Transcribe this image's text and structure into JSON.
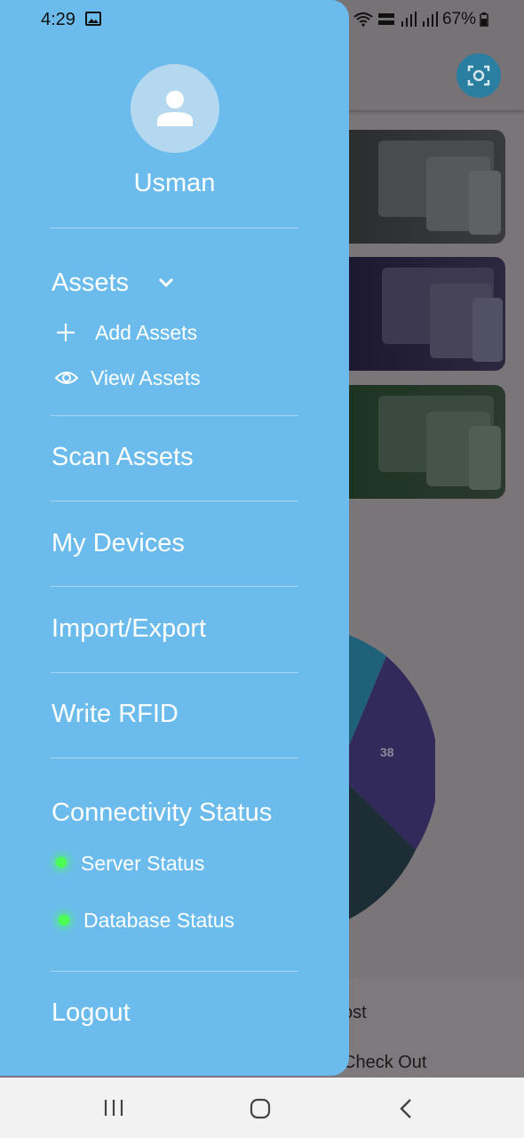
{
  "status_bar": {
    "time": "4:29",
    "battery": "67%"
  },
  "drawer": {
    "username": "Usman",
    "assets": {
      "label": "Assets",
      "items": [
        {
          "label": "Add Assets",
          "icon": "plus-icon"
        },
        {
          "label": "View Assets",
          "icon": "eye-icon"
        }
      ]
    },
    "menu": {
      "scan_assets": "Scan Assets",
      "my_devices": "My Devices",
      "import_export": "Import/Export",
      "write_rfid": "Write RFID",
      "logout": "Logout"
    },
    "connectivity": {
      "title": "Connectivity Status",
      "server": "Server Status",
      "database": "Database Status",
      "indicator_color": "#4cff53"
    },
    "background_color": "#6bbcec"
  },
  "background": {
    "pie_label": "38",
    "list_items": [
      "ost",
      "Check Out"
    ]
  }
}
